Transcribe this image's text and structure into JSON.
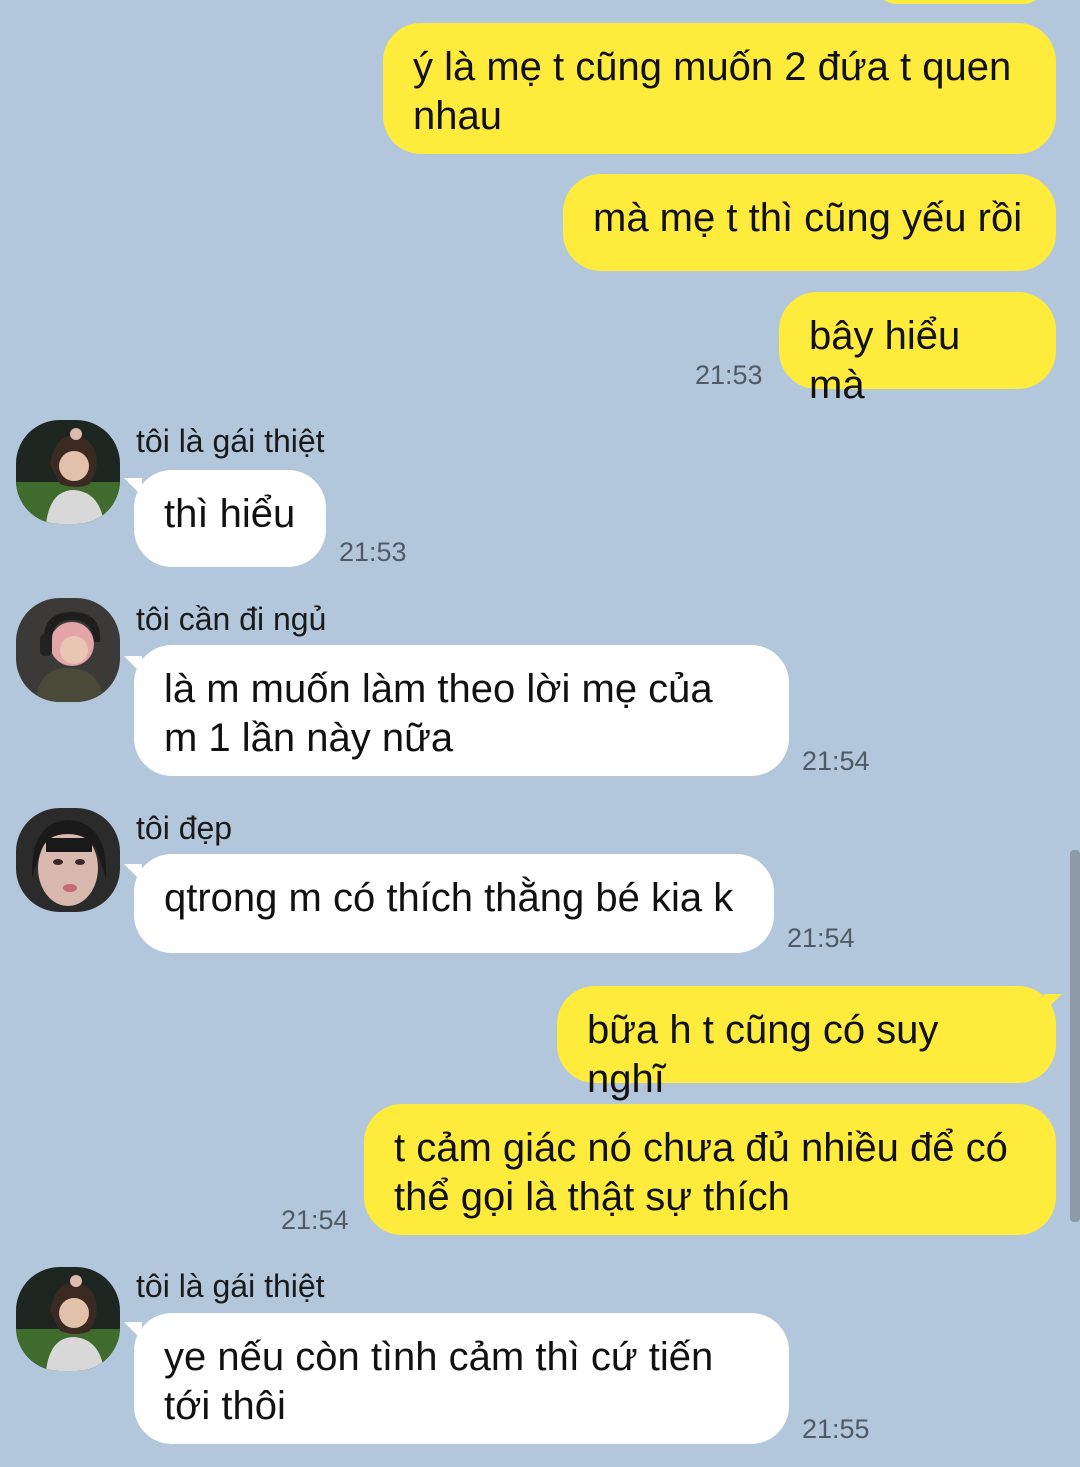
{
  "chat": {
    "messages": [
      {
        "direction": "out",
        "text": "ý là mẹ t cũng muốn 2 đứa t quen\nnhau"
      },
      {
        "direction": "out",
        "text": "mà mẹ t thì cũng yếu rồi"
      },
      {
        "direction": "out",
        "text": "bây hiểu mà",
        "time": "21:53"
      },
      {
        "direction": "in",
        "sender": "tôi là gái thiệt",
        "text": "thì hiểu",
        "time": "21:53"
      },
      {
        "direction": "in",
        "sender": "tôi cần đi ngủ",
        "text": "là m muốn làm theo lời mẹ của\nm 1 lần này nữa",
        "time": "21:54"
      },
      {
        "direction": "in",
        "sender": "tôi đẹp",
        "text": "qtrong m có thích thằng bé kia k",
        "time": "21:54"
      },
      {
        "direction": "out",
        "text": "bữa h t cũng có suy nghĩ"
      },
      {
        "direction": "out",
        "text": "t cảm giác nó chưa đủ nhiều để có\nthể gọi là thật sự thích",
        "time": "21:54"
      },
      {
        "direction": "in",
        "sender": "tôi là gái thiệt",
        "text": "ye nếu còn tình cảm thì cứ tiến\ntới thôi",
        "time": "21:55"
      }
    ]
  },
  "colors": {
    "background": "#b3c7dc",
    "outgoing_bubble": "#ffeb3b",
    "incoming_bubble": "#ffffff"
  }
}
